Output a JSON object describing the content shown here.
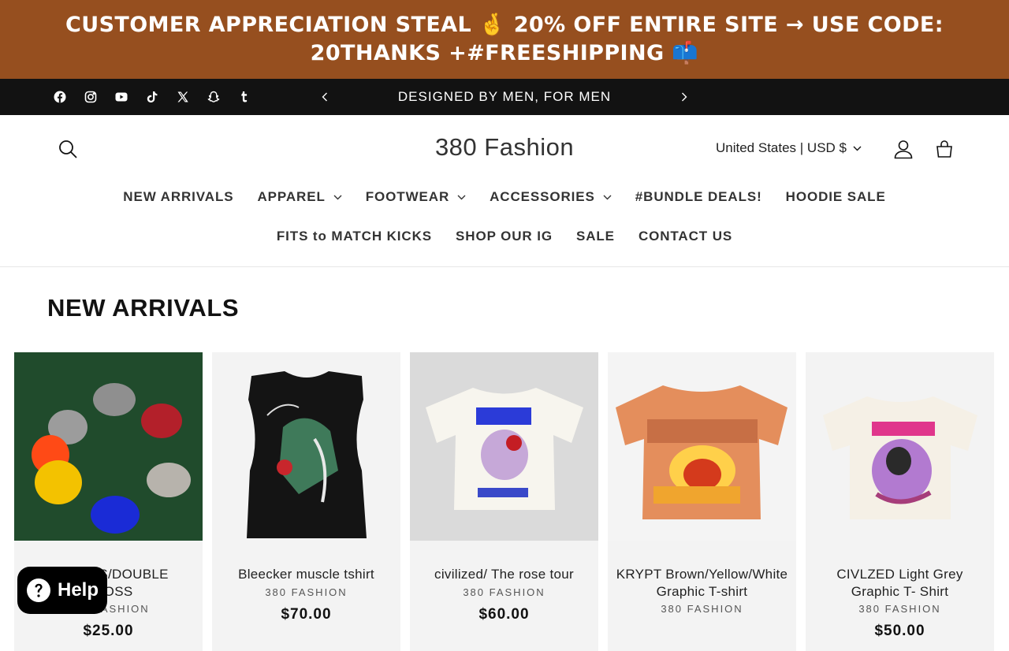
{
  "promo": {
    "text": "CUSTOMER APPRECIATION STEAL 🤞 20% OFF ENTIRE SITE → USE CODE: 20THANKS +#FREESHIPPING 📫",
    "bg": "#964f1f"
  },
  "announcement": {
    "text": "DESIGNED BY MEN, FOR MEN",
    "socials": [
      "facebook-icon",
      "instagram-icon",
      "youtube-icon",
      "tiktok-icon",
      "x-icon",
      "snapchat-icon",
      "tumblr-icon"
    ]
  },
  "header": {
    "logo": "380 Fashion",
    "country": "United States | USD $"
  },
  "nav": {
    "row1": [
      "NEW ARRIVALS",
      "APPAREL",
      "FOOTWEAR",
      "ACCESSORIES",
      "#BUNDLE DEALS!",
      "HOODIE SALE"
    ],
    "row2": [
      "FITS to MATCH KICKS",
      "SHOP OUR IG",
      "SALE",
      "CONTACT US"
    ]
  },
  "section": {
    "title": "NEW ARRIVALS"
  },
  "products": [
    {
      "name": "BEANIES/DOUBLE CROSS",
      "vendor": "380 FASHION",
      "price": "$25.00"
    },
    {
      "name": "Bleecker muscle tshirt",
      "vendor": "380 FASHION",
      "price": "$70.00"
    },
    {
      "name": "civilized/ The rose tour",
      "vendor": "380 FASHION",
      "price": "$60.00"
    },
    {
      "name": "KRYPT Brown/Yellow/White Graphic T-shirt",
      "vendor": "380 FASHION",
      "price": ""
    },
    {
      "name": "CIVLZED Light Grey Graphic T- Shirt",
      "vendor": "380 FASHION",
      "price": "$50.00"
    }
  ],
  "help": {
    "label": "Help"
  }
}
